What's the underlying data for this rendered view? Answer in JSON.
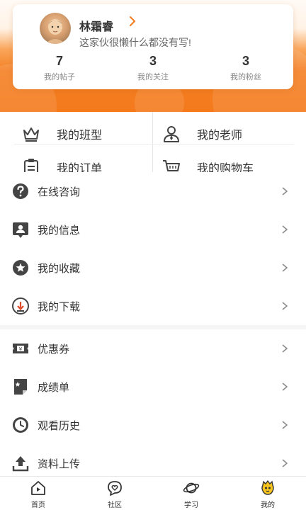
{
  "profile": {
    "username": "林霜睿",
    "bio": "这家伙很懒什么都没有写!",
    "stats": [
      {
        "value": "7",
        "label": "我的帖子"
      },
      {
        "value": "3",
        "label": "我的关注"
      },
      {
        "value": "3",
        "label": "我的粉丝"
      }
    ]
  },
  "grid": {
    "class": "我的班型",
    "teacher": "我的老师",
    "orders": "我的订单",
    "cart": "我的购物车"
  },
  "menu": {
    "consult": "在线咨询",
    "info": "我的信息",
    "favorites": "我的收藏",
    "downloads": "我的下载",
    "coupons": "优惠券",
    "grades": "成绩单",
    "history": "观看历史",
    "upload": "资料上传"
  },
  "tabbar": {
    "home": "首页",
    "community": "社区",
    "study": "学习",
    "mine": "我的"
  },
  "colors": {
    "accent": "#f47a1c",
    "icon": "#444444"
  }
}
